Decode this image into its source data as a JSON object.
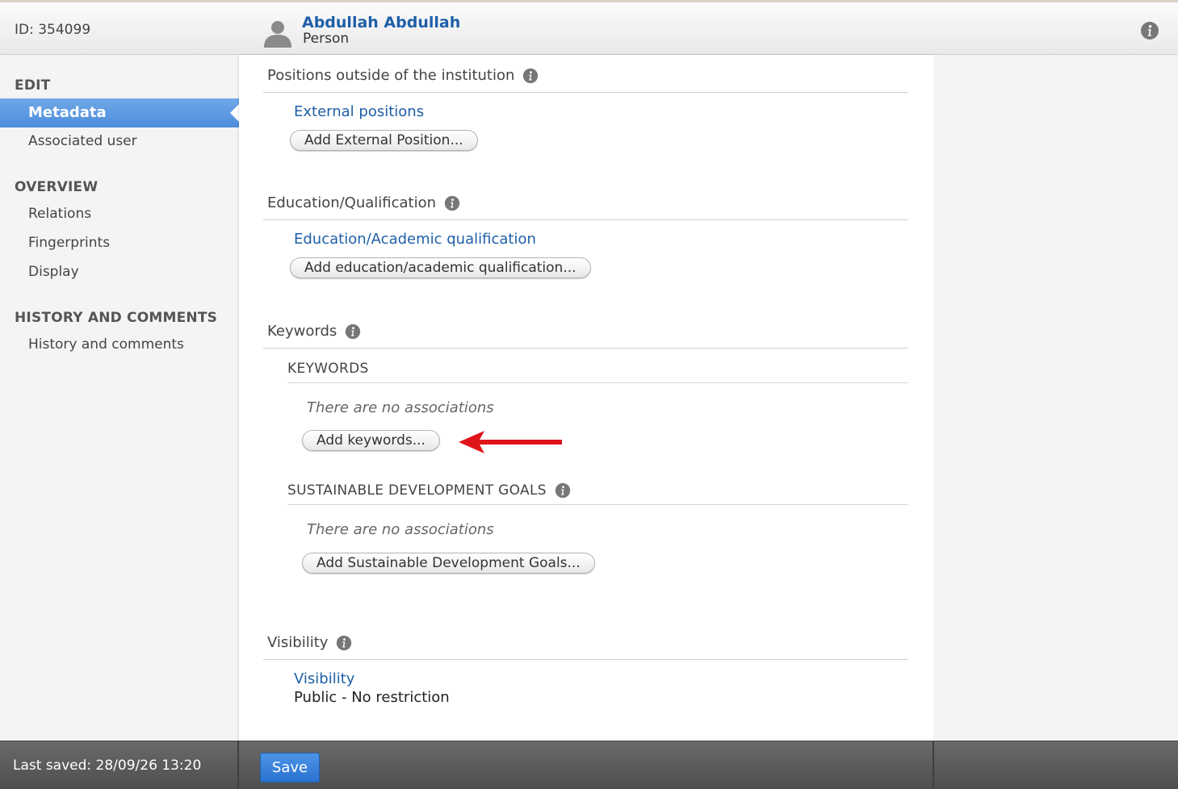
{
  "header": {
    "id_label": "ID: 354099",
    "person_name": "Abdullah Abdullah",
    "person_type": "Person"
  },
  "sidebar": {
    "groups": [
      {
        "title": "EDIT",
        "items": [
          "Metadata",
          "Associated user"
        ]
      },
      {
        "title": "OVERVIEW",
        "items": [
          "Relations",
          "Fingerprints",
          "Display"
        ]
      },
      {
        "title": "HISTORY AND COMMENTS",
        "items": [
          "History and comments"
        ]
      }
    ],
    "active_item": "Metadata"
  },
  "main": {
    "positions": {
      "title": "Positions outside of the institution",
      "link": "External positions",
      "button": "Add External Position..."
    },
    "education": {
      "title": "Education/Qualification",
      "link": "Education/Academic qualification",
      "button": "Add education/academic qualification..."
    },
    "keywords": {
      "title": "Keywords",
      "sub1_title": "KEYWORDS",
      "sub1_empty": "There are no associations",
      "sub1_button": "Add keywords...",
      "sub2_title": "SUSTAINABLE DEVELOPMENT GOALS",
      "sub2_empty": "There are no associations",
      "sub2_button": "Add Sustainable Development Goals..."
    },
    "visibility": {
      "title": "Visibility",
      "link": "Visibility",
      "value": "Public - No restriction"
    }
  },
  "footer": {
    "last_saved": "Last saved: 28/09/26 13:20",
    "save_label": "Save"
  },
  "colors": {
    "accent": "#4d8ddb",
    "link": "#1f5fa8",
    "annotation_arrow": "#e0141b"
  }
}
